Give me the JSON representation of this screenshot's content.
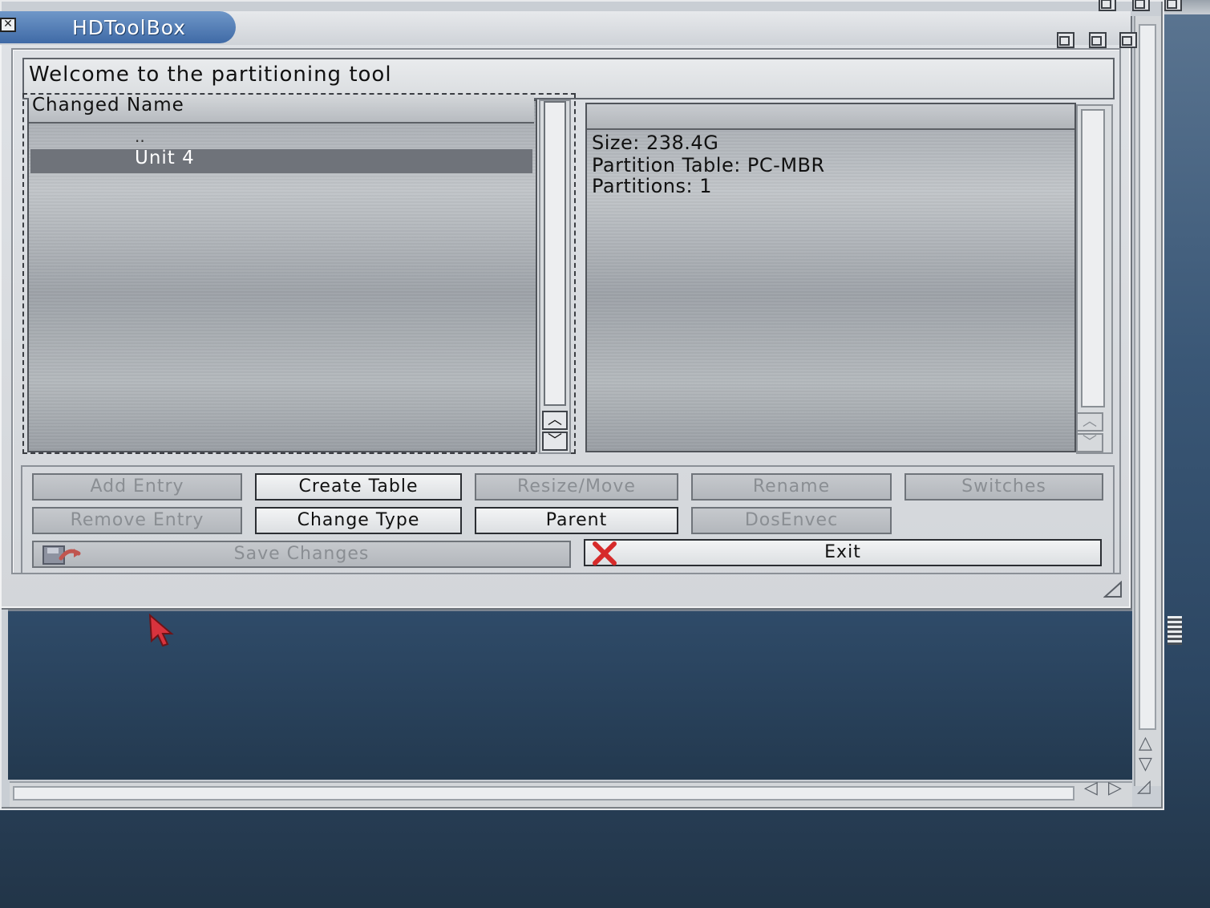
{
  "window": {
    "title": "HDToolBox"
  },
  "welcome_text": "Welcome to the partitioning tool",
  "device_list": {
    "header": "Changed Name",
    "parent_entry": "..",
    "items": [
      {
        "label": "Unit 4",
        "selected": true
      }
    ]
  },
  "info_panel": {
    "lines": [
      "Size: 238.4G",
      "Partition Table: PC-MBR",
      "Partitions: 1"
    ]
  },
  "buttons": {
    "add_entry": "Add Entry",
    "create_table": "Create Table",
    "resize_move": "Resize/Move",
    "rename": "Rename",
    "switches": "Switches",
    "remove_entry": "Remove Entry",
    "change_type": "Change Type",
    "parent": "Parent",
    "dosenvec": "DosEnvec",
    "save_changes": "Save Changes",
    "exit": "Exit"
  },
  "colors": {
    "title_accent": "#4f78b0",
    "exit_icon": "#d62a2a",
    "desktop": "#2f4b69"
  },
  "icons": {
    "save": "save-disk-icon",
    "exit": "red-x-icon",
    "cursor": "mouse-pointer-icon"
  }
}
